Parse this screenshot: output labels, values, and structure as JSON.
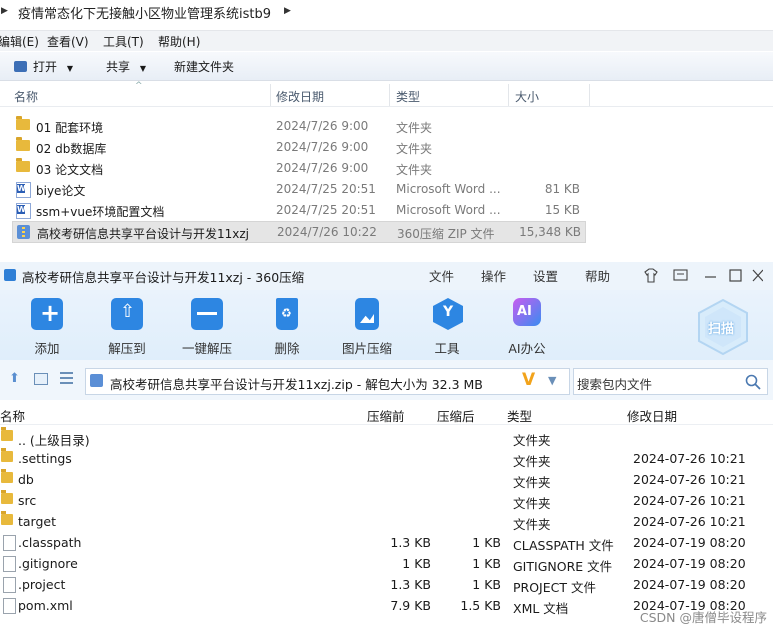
{
  "explorer": {
    "address": "疫情常态化下无接触小区物业管理系统istb9",
    "menu": [
      "编辑(E)",
      "查看(V)",
      "工具(T)",
      "帮助(H)"
    ],
    "toolbar": {
      "open": "打开",
      "share": "共享",
      "new_folder": "新建文件夹"
    },
    "columns": {
      "name": "名称",
      "modified": "修改日期",
      "type": "类型",
      "size": "大小"
    },
    "files": [
      {
        "icon": "folder-icon",
        "name": "01 配套环境",
        "modified": "2024/7/26 9:00",
        "type": "文件夹",
        "size": ""
      },
      {
        "icon": "folder-icon",
        "name": "02 db数据库",
        "modified": "2024/7/26 9:00",
        "type": "文件夹",
        "size": ""
      },
      {
        "icon": "folder-icon",
        "name": "03 论文文档",
        "modified": "2024/7/26 9:00",
        "type": "文件夹",
        "size": ""
      },
      {
        "icon": "word-doc-icon",
        "name": "biye论文",
        "modified": "2024/7/25 20:51",
        "type": "Microsoft Word ...",
        "size": "81 KB"
      },
      {
        "icon": "word-doc-icon",
        "name": "ssm+vue环境配置文档",
        "modified": "2024/7/25 20:51",
        "type": "Microsoft Word ...",
        "size": "15 KB"
      },
      {
        "icon": "zip-icon",
        "name": "高校考研信息共享平台设计与开发11xzj",
        "modified": "2024/7/26 10:22",
        "type": "360压缩 ZIP 文件",
        "size": "15,348 KB"
      }
    ]
  },
  "zipwin": {
    "title": "高校考研信息共享平台设计与开发11xzj - 360压缩",
    "menu": [
      "文件",
      "操作",
      "设置",
      "帮助"
    ],
    "ribbon": [
      "添加",
      "解压到",
      "一键解压",
      "删除",
      "图片压缩",
      "工具",
      "AI办公"
    ],
    "scan": "扫描",
    "path": "高校考研信息共享平台设计与开发11xzj.zip - 解包大小为 32.3 MB",
    "search_placeholder": "搜索包内文件",
    "columns": {
      "name": "名称",
      "before": "压缩前",
      "after": "压缩后",
      "type": "类型",
      "modified": "修改日期"
    },
    "rows": [
      {
        "icon": "folder-icon",
        "name": ".. (上级目录)",
        "before": "",
        "after": "",
        "type": "文件夹",
        "modified": ""
      },
      {
        "icon": "folder-icon",
        "name": ".settings",
        "before": "",
        "after": "",
        "type": "文件夹",
        "modified": "2024-07-26 10:21"
      },
      {
        "icon": "folder-icon",
        "name": "db",
        "before": "",
        "after": "",
        "type": "文件夹",
        "modified": "2024-07-26 10:21"
      },
      {
        "icon": "folder-icon",
        "name": "src",
        "before": "",
        "after": "",
        "type": "文件夹",
        "modified": "2024-07-26 10:21"
      },
      {
        "icon": "folder-icon",
        "name": "target",
        "before": "",
        "after": "",
        "type": "文件夹",
        "modified": "2024-07-26 10:21"
      },
      {
        "icon": "file-icon",
        "name": ".classpath",
        "before": "1.3 KB",
        "after": "1 KB",
        "type": "CLASSPATH 文件",
        "modified": "2024-07-19 08:20"
      },
      {
        "icon": "file-icon",
        "name": ".gitignore",
        "before": "1 KB",
        "after": "1 KB",
        "type": "GITIGNORE 文件",
        "modified": "2024-07-19 08:20"
      },
      {
        "icon": "file-icon",
        "name": ".project",
        "before": "1.3 KB",
        "after": "1 KB",
        "type": "PROJECT 文件",
        "modified": "2024-07-19 08:20"
      },
      {
        "icon": "xml-file-icon",
        "name": "pom.xml",
        "before": "7.9 KB",
        "after": "1.5 KB",
        "type": "XML 文档",
        "modified": "2024-07-19 08:20"
      }
    ]
  },
  "watermark": "CSDN @唐僧毕设程序"
}
